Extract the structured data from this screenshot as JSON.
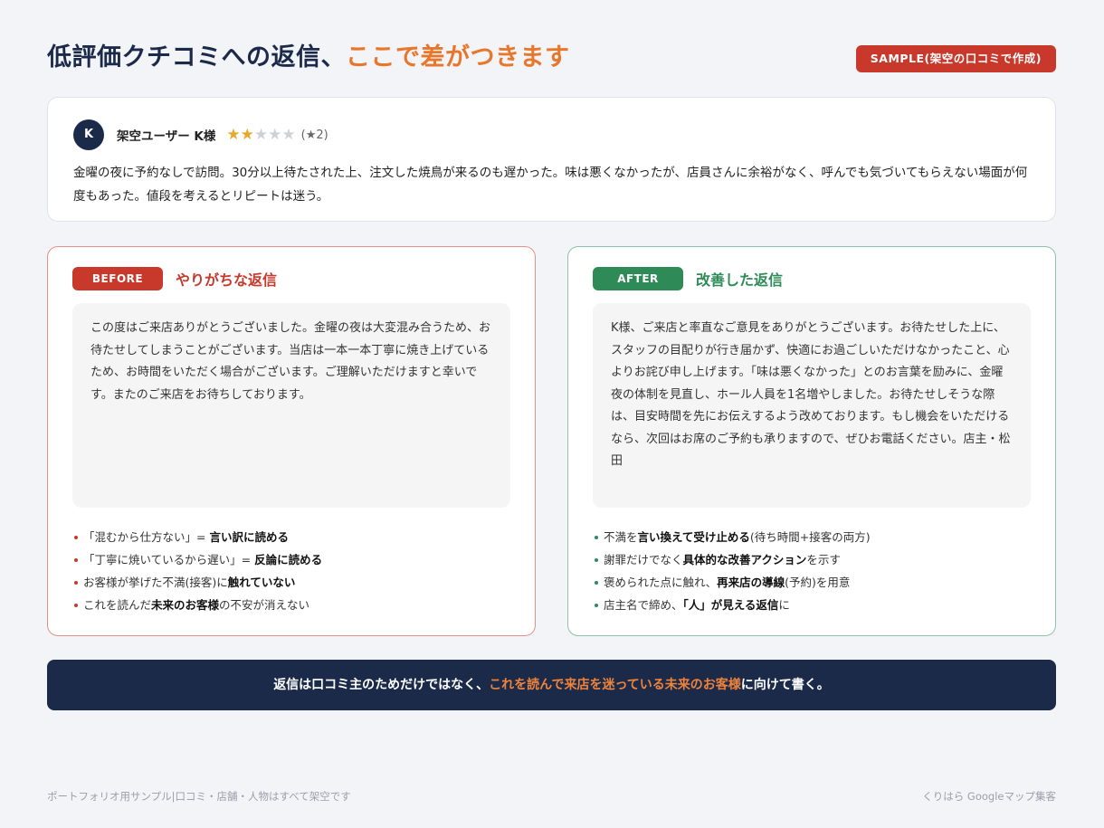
{
  "header": {
    "title_main": "低評価クチコミへの返信、",
    "title_accent": "ここで差がつきます",
    "sample_badge": "SAMPLE(架空の口コミで作成)"
  },
  "review": {
    "avatar_initial": "K",
    "reviewer_name": "架空ユーザー K様",
    "stars_total": 5,
    "stars_filled": 2,
    "rating_label": "(★2)",
    "text": "金曜の夜に予約なしで訪問。30分以上待たされた上、注文した焼鳥が来るのも遅かった。味は悪くなかったが、店員さんに余裕がなく、呼んでも気づいてもらえない場面が何度もあった。値段を考えるとリピートは迷う。"
  },
  "before": {
    "tag": "BEFORE",
    "label": "やりがちな返信",
    "reply": "この度はご来店ありがとうございました。金曜の夜は大変混み合うため、お待たせしてしまうことがございます。当店は一本一本丁寧に焼き上げているため、お時間をいただく場合がございます。ご理解いただけますと幸いです。またのご来店をお待ちしております。",
    "points": [
      {
        "pre": "「混むから仕方ない」= ",
        "bold": "言い訳に読める",
        "post": ""
      },
      {
        "pre": "「丁寧に焼いているから遅い」= ",
        "bold": "反論に読める",
        "post": ""
      },
      {
        "pre": "お客様が挙げた不満(接客)に",
        "bold": "触れていない",
        "post": ""
      },
      {
        "pre": "これを読んだ",
        "bold": "未来のお客様",
        "post": "の不安が消えない"
      }
    ]
  },
  "after": {
    "tag": "AFTER",
    "label": "改善した返信",
    "reply": "K様、ご来店と率直なご意見をありがとうございます。お待たせした上に、スタッフの目配りが行き届かず、快適にお過ごしいただけなかったこと、心よりお詫び申し上げます。「味は悪くなかった」とのお言葉を励みに、金曜夜の体制を見直し、ホール人員を1名増やしました。お待たせしそうな際は、目安時間を先にお伝えするよう改めております。もし機会をいただけるなら、次回はお席のご予約も承りますので、ぜひお電話ください。店主・松田",
    "points": [
      {
        "pre": "不満を",
        "bold": "言い換えて受け止める",
        "post": "(待ち時間+接客の両方)"
      },
      {
        "pre": "謝罪だけでなく",
        "bold": "具体的な改善アクション",
        "post": "を示す"
      },
      {
        "pre": "褒められた点に触れ、",
        "bold": "再来店の導線",
        "post": "(予約)を用意"
      },
      {
        "pre": "店主名で締め、",
        "bold": "「人」が見える返信",
        "post": "に"
      }
    ]
  },
  "banner": {
    "pre": "返信は口コミ主のためだけではなく、",
    "accent": "これを読んで来店を迷っている未来のお客様",
    "post": "に向けて書く。"
  },
  "footer": {
    "left": "ポートフォリオ用サンプル|口コミ・店舗・人物はすべて架空です",
    "right": "くりはら Googleマップ集客"
  },
  "colors": {
    "navy": "#1c2a4a",
    "accent_orange": "#e8762b",
    "before_red": "#c8392b",
    "after_green": "#2e8b57",
    "star_gold": "#e7a82b"
  }
}
